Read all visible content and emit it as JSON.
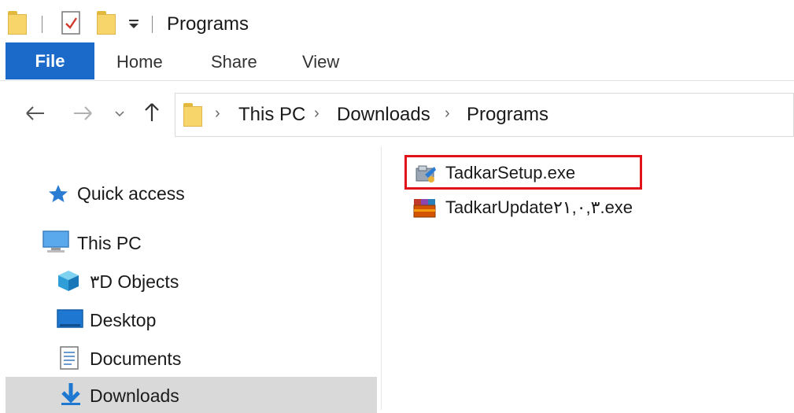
{
  "window": {
    "title": "Programs"
  },
  "ribbon": {
    "tabs": [
      "File",
      "Home",
      "Share",
      "View"
    ]
  },
  "navigation": {
    "back_icon": "arrow-left-icon",
    "forward_icon": "arrow-right-icon",
    "recent_icon": "chevron-down-icon",
    "up_icon": "arrow-up-icon"
  },
  "address_bar": {
    "breadcrumbs": [
      "This PC",
      "Downloads",
      "Programs"
    ]
  },
  "sidebar": {
    "quick_access": "Quick access",
    "this_pc": "This PC",
    "items": [
      {
        "label": "۳D Objects",
        "icon": "cube-icon"
      },
      {
        "label": "Desktop",
        "icon": "desktop-icon"
      },
      {
        "label": "Documents",
        "icon": "document-icon"
      },
      {
        "label": "Downloads",
        "icon": "download-arrow-icon",
        "selected": true
      }
    ]
  },
  "files": [
    {
      "name": "TadkarSetup.exe",
      "icon": "installer-icon",
      "highlighted": true
    },
    {
      "name": "TadkarUpdate۲۱,۰,۳.exe",
      "icon": "archive-icon"
    }
  ],
  "colors": {
    "file_tab": "#1b6ac9",
    "highlight_border": "#e0121a",
    "selected_row": "#d9d9d9"
  }
}
